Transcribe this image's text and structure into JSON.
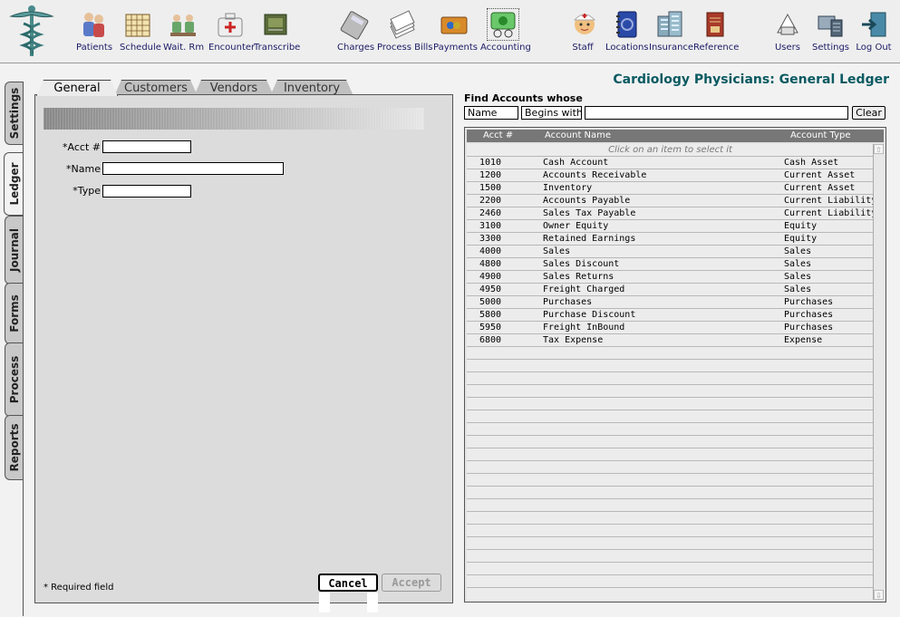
{
  "toolbar": {
    "items": [
      {
        "label": "Patients",
        "icon": "patients-icon"
      },
      {
        "label": "Schedule",
        "icon": "calendar-icon"
      },
      {
        "label": "Wait. Rm",
        "icon": "waiting-room-icon"
      },
      {
        "label": "Encounter",
        "icon": "medical-kit-icon"
      },
      {
        "label": "Transcribe",
        "icon": "transcribe-icon"
      },
      {
        "label": "Charges",
        "icon": "calculator-icon"
      },
      {
        "label": "Process Bills",
        "icon": "bills-stack-icon"
      },
      {
        "label": "Payments",
        "icon": "credit-card-icon"
      },
      {
        "label": "Accounting",
        "icon": "accounting-money-icon"
      },
      {
        "label": "Staff",
        "icon": "nurse-icon"
      },
      {
        "label": "Locations",
        "icon": "address-book-icon"
      },
      {
        "label": "Insurance",
        "icon": "building-icon"
      },
      {
        "label": "Reference",
        "icon": "books-icon"
      },
      {
        "label": "Users",
        "icon": "users-icon"
      },
      {
        "label": "Settings",
        "icon": "settings-computer-icon"
      },
      {
        "label": "Log Out",
        "icon": "logout-door-icon"
      }
    ],
    "active": "Accounting"
  },
  "page_title": "Cardiology Physicians: General Ledger",
  "side_tabs": [
    "Settings",
    "Ledger",
    "Journal",
    "Forms",
    "Process",
    "Reports"
  ],
  "side_tab_active": "Ledger",
  "form_tabs": [
    "General",
    "Customers",
    "Vendors",
    "Inventory"
  ],
  "form_tab_active": "General",
  "form": {
    "acct_label": "*Acct #",
    "name_label": "*Name",
    "type_label": "*Type",
    "acct_value": "",
    "name_value": "",
    "type_value": "",
    "required_note": "* Required field",
    "cancel_label": "Cancel",
    "accept_label": "Accept"
  },
  "find": {
    "label": "Find Accounts whose",
    "field": "Name",
    "condition": "Begins with",
    "value": "",
    "clear_label": "Clear"
  },
  "table": {
    "columns": [
      "Acct #",
      "Account Name",
      "Account Type"
    ],
    "hint": "Click on an item to select it",
    "rows": [
      {
        "acct": "1010",
        "name": "Cash Account",
        "type": "Cash Asset"
      },
      {
        "acct": "1200",
        "name": "Accounts Receivable",
        "type": "Current Asset"
      },
      {
        "acct": "1500",
        "name": "Inventory",
        "type": "Current Asset"
      },
      {
        "acct": "2200",
        "name": "Accounts Payable",
        "type": "Current Liability"
      },
      {
        "acct": "2460",
        "name": "Sales Tax Payable",
        "type": "Current Liability"
      },
      {
        "acct": "3100",
        "name": "Owner Equity",
        "type": "Equity"
      },
      {
        "acct": "3300",
        "name": "Retained Earnings",
        "type": "Equity"
      },
      {
        "acct": "4000",
        "name": "Sales",
        "type": "Sales"
      },
      {
        "acct": "4800",
        "name": "Sales Discount",
        "type": "Sales"
      },
      {
        "acct": "4900",
        "name": "Sales Returns",
        "type": "Sales"
      },
      {
        "acct": "4950",
        "name": "Freight Charged",
        "type": "Sales"
      },
      {
        "acct": "5000",
        "name": "Purchases",
        "type": "Purchases"
      },
      {
        "acct": "5800",
        "name": "Purchase Discount",
        "type": "Purchases"
      },
      {
        "acct": "5950",
        "name": "Freight InBound",
        "type": "Purchases"
      },
      {
        "acct": "6800",
        "name": "Tax Expense",
        "type": "Expense"
      }
    ]
  },
  "colors": {
    "title": "#0a5a62",
    "toolbar_label": "#1a1a66",
    "table_header": "#777777"
  }
}
